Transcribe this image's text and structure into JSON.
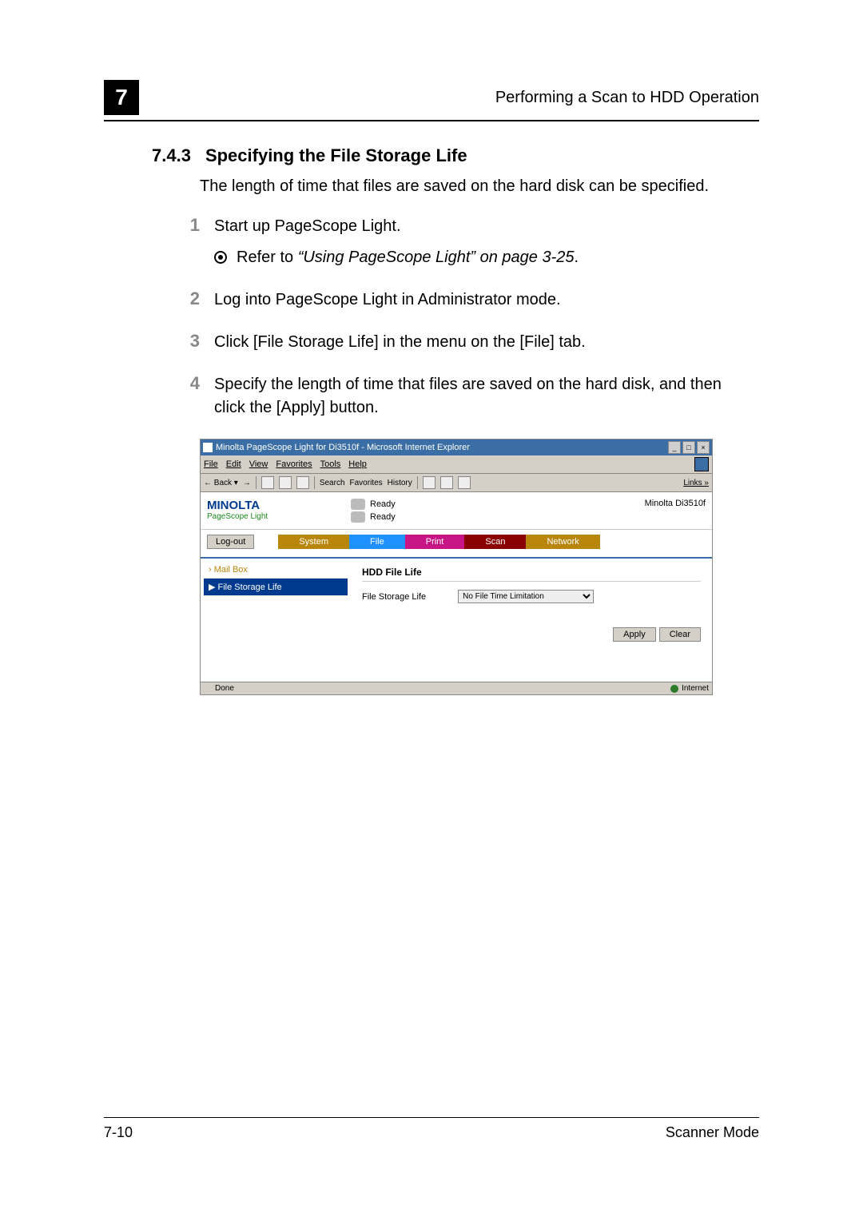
{
  "header": {
    "chapter": "7",
    "running_title": "Performing a Scan to HDD Operation"
  },
  "section": {
    "number": "7.4.3",
    "title": "Specifying the File Storage Life",
    "intro": "The length of time that files are saved on the hard disk can be specified."
  },
  "steps": [
    {
      "n": "1",
      "text": "Start up PageScope Light.",
      "sub": {
        "prefix": "Refer to ",
        "ital": "“Using PageScope Light” on page 3-25",
        "suffix": "."
      }
    },
    {
      "n": "2",
      "text": "Log into PageScope Light in Administrator mode."
    },
    {
      "n": "3",
      "text": "Click [File Storage Life] in the menu on the [File] tab."
    },
    {
      "n": "4",
      "text": "Specify the length of time that files are saved on the hard disk, and then click the [Apply] button."
    }
  ],
  "screenshot": {
    "window_title": "Minolta PageScope Light for Di3510f - Microsoft Internet Explorer",
    "menu": {
      "file": "File",
      "edit": "Edit",
      "view": "View",
      "favorites": "Favorites",
      "tools": "Tools",
      "help": "Help"
    },
    "toolbar": {
      "back": "Back",
      "search": "Search",
      "favorites": "Favorites",
      "history": "History",
      "links": "Links »"
    },
    "brand": {
      "name": "MINOLTA",
      "sub": "PageScope Light"
    },
    "status": {
      "s1": "Ready",
      "s2": "Ready"
    },
    "model": "Minolta Di3510f",
    "logout": "Log-out",
    "tabs": {
      "system": "System",
      "file": "File",
      "print": "Print",
      "scan": "Scan",
      "network": "Network"
    },
    "side": {
      "mailbox": "› Mail Box",
      "fsl": "▶ File Storage Life"
    },
    "main": {
      "heading": "HDD File Life",
      "label": "File Storage Life",
      "select": "No File Time Limitation",
      "apply": "Apply",
      "clear": "Clear"
    },
    "statusbar": {
      "done": "Done",
      "zone": "Internet"
    }
  },
  "footer": {
    "page": "7-10",
    "mode": "Scanner Mode"
  }
}
